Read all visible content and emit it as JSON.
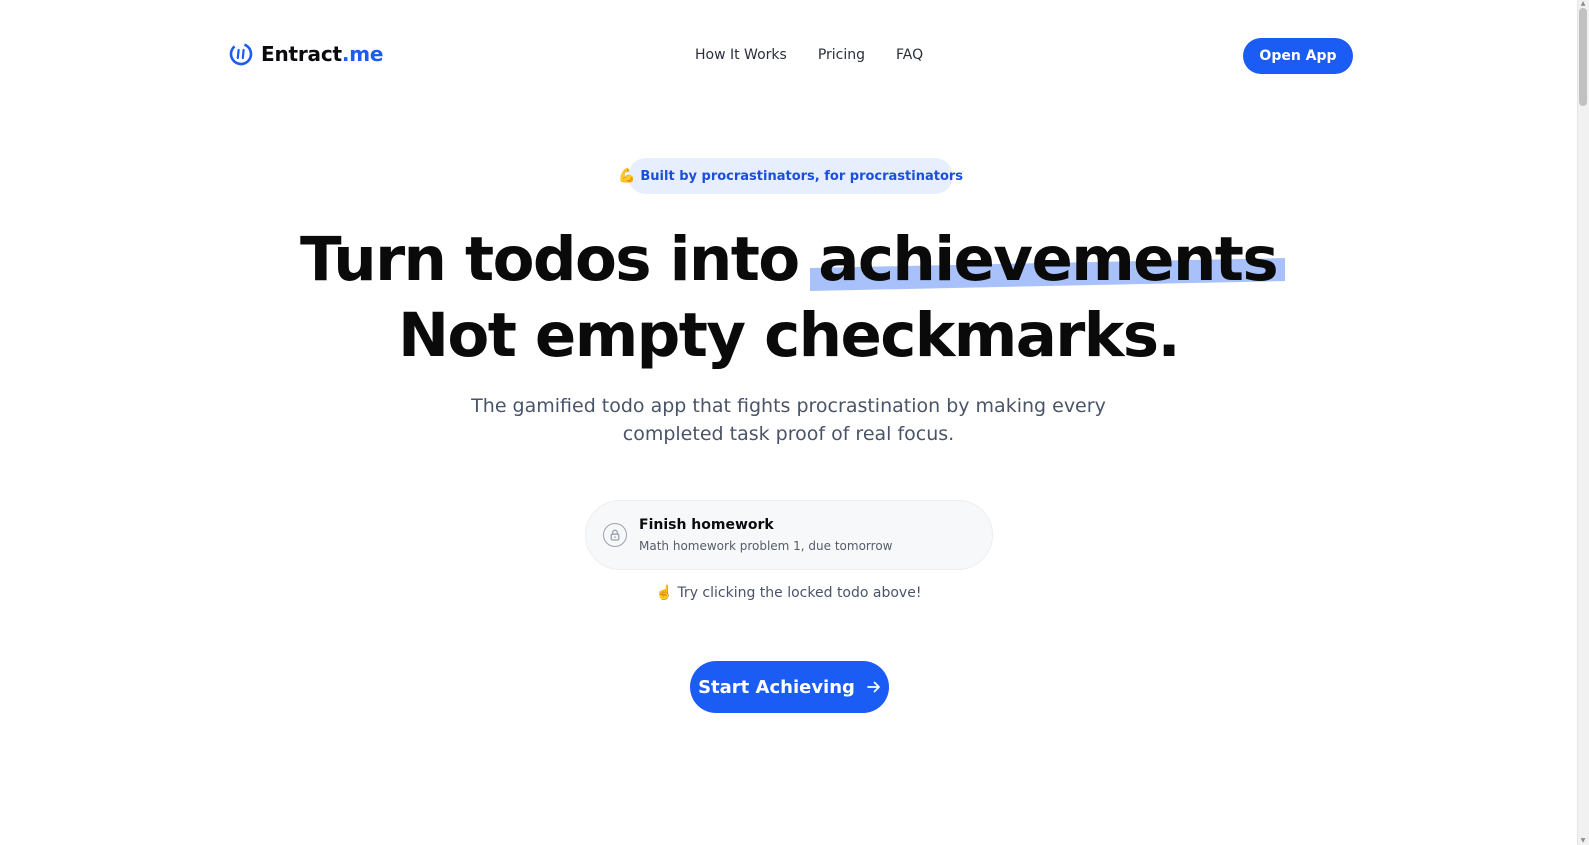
{
  "header": {
    "logo_text": "Entract",
    "logo_accent": ".me",
    "nav": [
      {
        "label": "How It Works"
      },
      {
        "label": "Pricing"
      },
      {
        "label": "FAQ"
      }
    ],
    "open_app_label": "Open App"
  },
  "hero": {
    "badge_icon": "💪",
    "badge_text": "Built by procrastinators, for procrastinators",
    "headline_prefix": "Turn todos into ",
    "headline_highlight": "achievements",
    "headline_line2": "Not empty checkmarks.",
    "subtitle_line1": "The gamified todo app that fights procrastination by making every",
    "subtitle_line2": "completed task proof of real focus."
  },
  "todo": {
    "title": "Finish homework",
    "description": "Math homework problem 1, due tomorrow",
    "icon": "lock-icon"
  },
  "hint": {
    "icon": "☝️",
    "text": "Try clicking the locked todo above!"
  },
  "cta": {
    "label": "Start Achieving",
    "icon": "arrow-right-icon"
  },
  "colors": {
    "brand": "#1b5cf5",
    "highlight": "#a8c1fb",
    "badge_bg": "#e7efff"
  }
}
